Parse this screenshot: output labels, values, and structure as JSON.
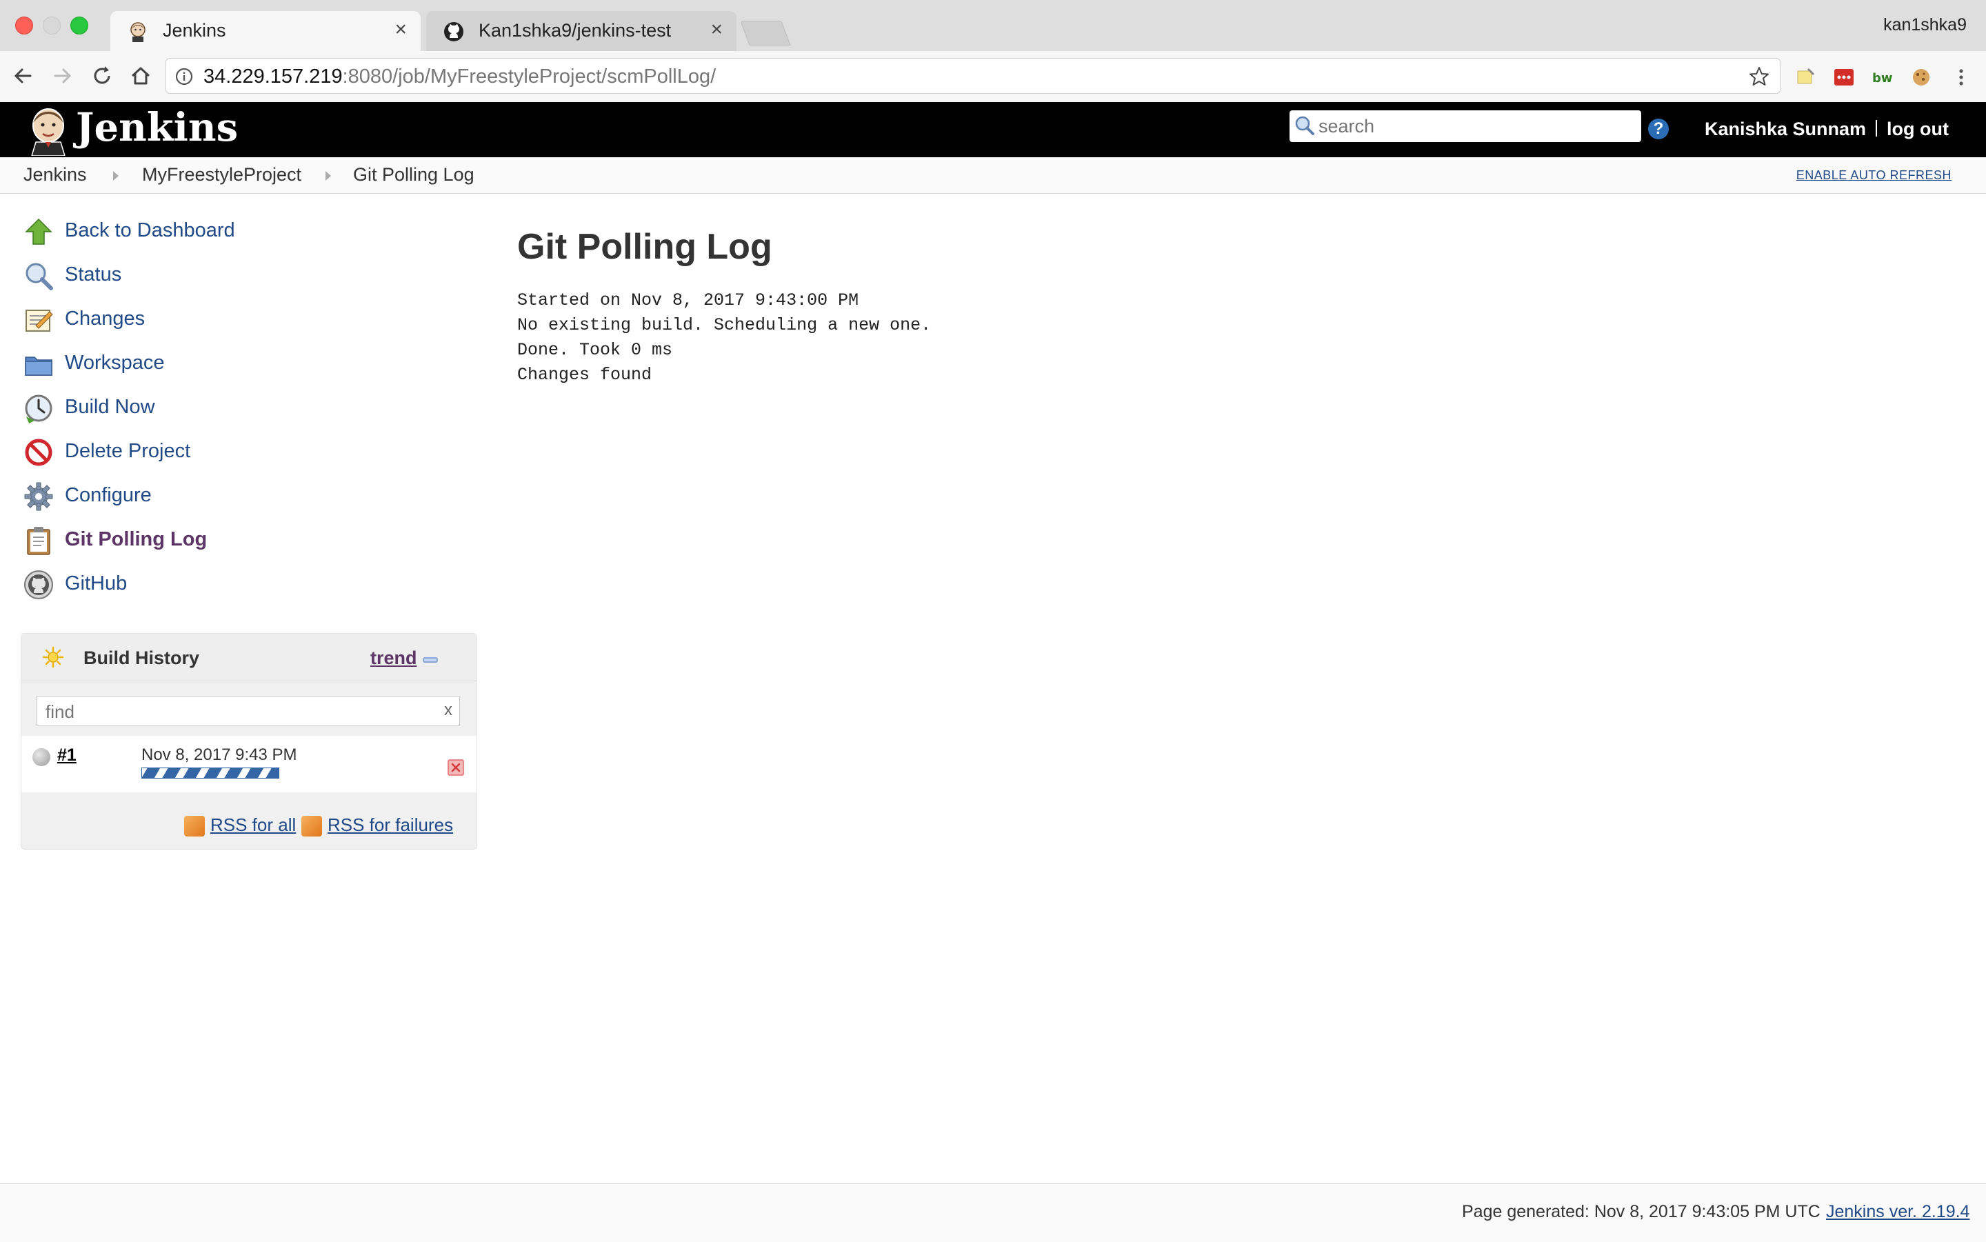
{
  "browser": {
    "tabs": [
      {
        "title": "Jenkins",
        "active": true
      },
      {
        "title": "Kan1shka9/jenkins-test",
        "active": false
      }
    ],
    "profile": "kan1shka9",
    "url_host": "34.229.157.219",
    "url_path": ":8080/job/MyFreestyleProject/scmPollLog/"
  },
  "header": {
    "logo": "Jenkins",
    "search_placeholder": "search",
    "help": "?",
    "user": "Kanishka Sunnam",
    "logout": "log out"
  },
  "breadcrumb": {
    "items": [
      "Jenkins",
      "MyFreestyleProject",
      "Git Polling Log"
    ],
    "auto_refresh": "ENABLE AUTO REFRESH"
  },
  "sidebar": {
    "tasks": [
      {
        "label": "Back to Dashboard",
        "icon": "up-arrow-icon"
      },
      {
        "label": "Status",
        "icon": "magnifier-icon"
      },
      {
        "label": "Changes",
        "icon": "notepad-icon"
      },
      {
        "label": "Workspace",
        "icon": "folder-icon"
      },
      {
        "label": "Build Now",
        "icon": "clock-icon"
      },
      {
        "label": "Delete Project",
        "icon": "no-entry-icon"
      },
      {
        "label": "Configure",
        "icon": "gear-icon"
      },
      {
        "label": "Git Polling Log",
        "icon": "clipboard-icon"
      },
      {
        "label": "GitHub",
        "icon": "github-icon"
      }
    ]
  },
  "build_history": {
    "title": "Build History",
    "trend": "trend",
    "search_placeholder": "find",
    "clear": "x",
    "builds": [
      {
        "number": "#1",
        "date": "Nov 8, 2017 9:43 PM"
      }
    ],
    "rss_all": "RSS for all",
    "rss_failures": "RSS for failures"
  },
  "main": {
    "title": "Git Polling Log",
    "log_lines": [
      "Started on Nov 8, 2017 9:43:00 PM",
      "No existing build. Scheduling a new one.",
      "Done. Took 0 ms",
      "Changes found"
    ]
  },
  "footer": {
    "generated": "Page generated: Nov 8, 2017 9:43:05 PM UTC",
    "version": "Jenkins ver. 2.19.4"
  },
  "colors": {
    "header_bg": "#000000",
    "link": "#204a87",
    "visited": "#5c3566"
  }
}
